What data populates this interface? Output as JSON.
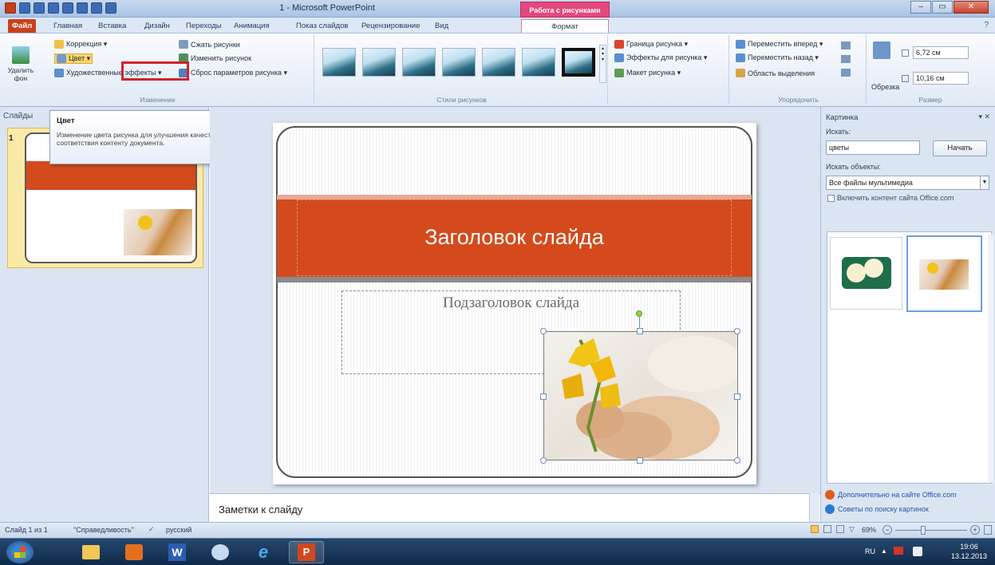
{
  "window": {
    "title": "1 - Microsoft PowerPoint",
    "context_tab": "Работа с рисунками"
  },
  "tabs": [
    {
      "label": "Файл"
    },
    {
      "label": "Главная"
    },
    {
      "label": "Вставка"
    },
    {
      "label": "Дизайн"
    },
    {
      "label": "Переходы"
    },
    {
      "label": "Анимация"
    },
    {
      "label": "Показ слайдов"
    },
    {
      "label": "Рецензирование"
    },
    {
      "label": "Вид"
    },
    {
      "label": "Формат"
    }
  ],
  "ribbon": {
    "remove_bg": "Удалить фон",
    "correction": "Коррекция ▾",
    "color": "Цвет ▾",
    "artistic": "Художественные эффекты ▾",
    "compress": "Сжать рисунки",
    "change": "Изменить рисунок",
    "reset": "Сброс параметров рисунка ▾",
    "group_change": "Изменение",
    "group_styles": "Стили рисунков",
    "border": "Граница рисунка ▾",
    "effects": "Эффекты для рисунка ▾",
    "layout": "Макет рисунка ▾",
    "bring_forward": "Переместить вперед ▾",
    "send_backward": "Переместить назад ▾",
    "selection_pane": "Область выделения",
    "group_arrange": "Упорядочить",
    "crop": "Обрезка",
    "height": "6,72 см",
    "width": "10,16 см",
    "group_size": "Размер"
  },
  "tooltip": {
    "title": "Цвет",
    "body": "Изменение цвета рисунка для улучшения качества или соответствия контенту документа."
  },
  "slides_pane": {
    "header": "Слайды",
    "slide_number": "1"
  },
  "slide": {
    "title": "Заголовок слайда",
    "subtitle": "Подзаголовок слайда"
  },
  "notes": {
    "text": "Заметки к слайду"
  },
  "clipart": {
    "header": "Картинка",
    "search_label": "Искать:",
    "search_value": "цветы",
    "search_button": "Начать",
    "objects_label": "Искать объекты:",
    "objects_value": "Все файлы мультимедиа",
    "include_office": "Включить контент сайта Office.com",
    "link_more": "Дополнительно на сайте Office.com",
    "link_tips": "Советы по поиску картинок"
  },
  "status": {
    "slide": "Слайд 1 из 1",
    "theme": "\"Справедливость\"",
    "lang": "русский",
    "zoom": "69%"
  },
  "taskbar": {
    "lang": "RU",
    "time": "19:06",
    "date": "13.12.2013"
  },
  "colors": {
    "accent": "#d44a1c",
    "ribbon": "#dde8f6",
    "context": "#e5487c"
  }
}
